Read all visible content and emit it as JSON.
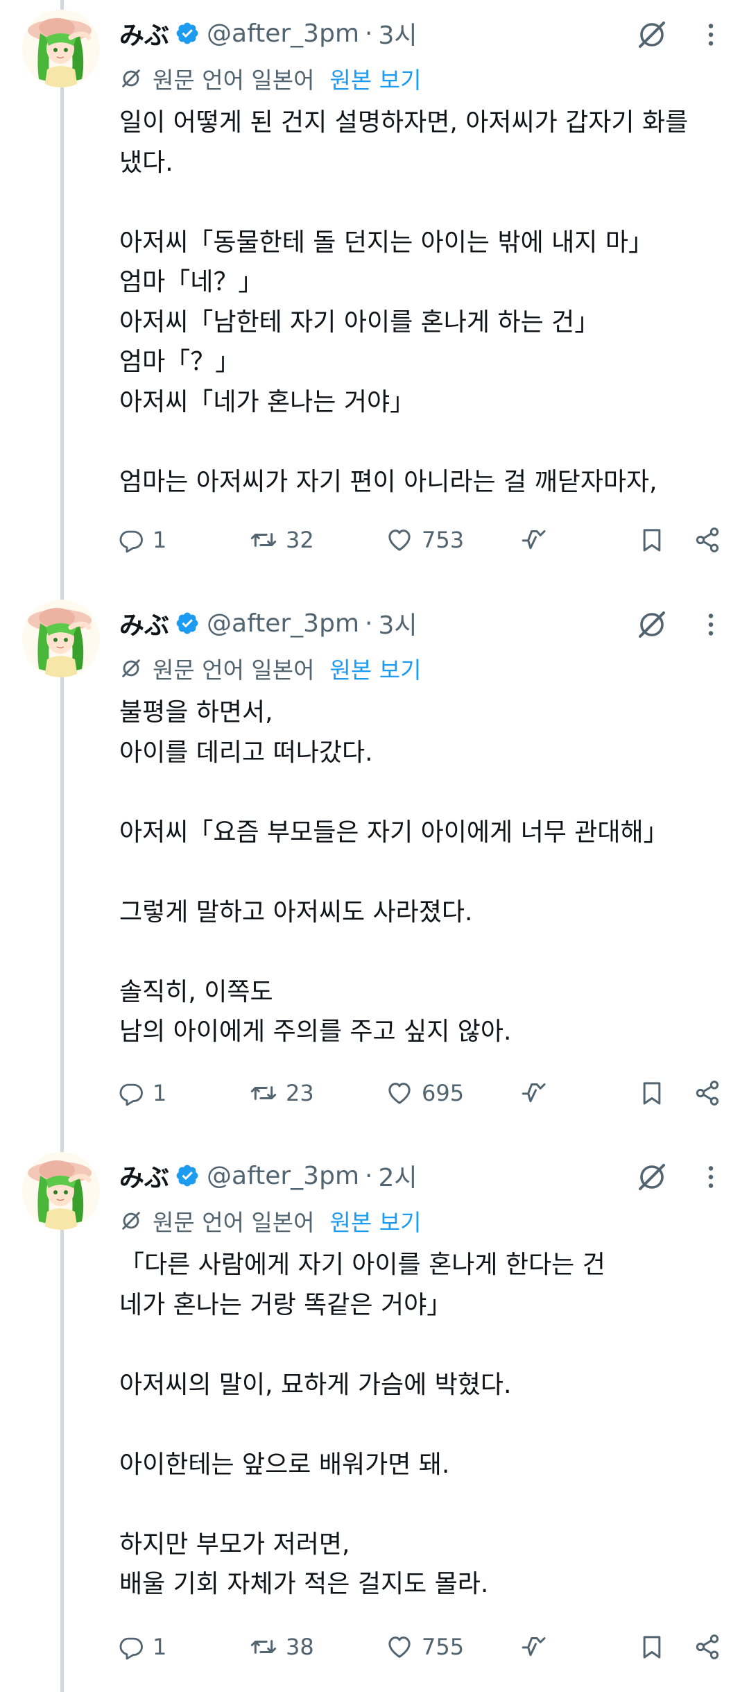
{
  "tweets": [
    {
      "author_name": "みぶ",
      "handle": "@after_3pm",
      "separator": "·",
      "time": "3시",
      "translation_note": "원문 언어 일본어",
      "show_original": "원본 보기",
      "lines": [
        "일이 어떻게 된 건지 설명하자면, 아저씨가 갑자기 화를",
        "냈다.",
        "",
        "아저씨「동물한테 돌 던지는 아이는 밖에 내지 마」",
        "엄마「네？」",
        "아저씨「남한테 자기 아이를 혼나게 하는 건」",
        "엄마「？」",
        "아저씨「네가 혼나는 거야」",
        "",
        "엄마는 아저씨가 자기 편이 아니라는 걸 깨닫자마자,"
      ],
      "replies": "1",
      "reposts": "32",
      "likes": "753"
    },
    {
      "author_name": "みぶ",
      "handle": "@after_3pm",
      "separator": "·",
      "time": "3시",
      "translation_note": "원문 언어 일본어",
      "show_original": "원본 보기",
      "lines": [
        "불평을 하면서,",
        "아이를 데리고 떠나갔다.",
        "",
        "아저씨「요즘 부모들은 자기 아이에게 너무 관대해」",
        "",
        "그렇게 말하고 아저씨도 사라졌다.",
        "",
        "솔직히, 이쪽도",
        "남의 아이에게 주의를 주고 싶지 않아."
      ],
      "replies": "1",
      "reposts": "23",
      "likes": "695"
    },
    {
      "author_name": "みぶ",
      "handle": "@after_3pm",
      "separator": "·",
      "time": "2시",
      "translation_note": "원문 언어 일본어",
      "show_original": "원본 보기",
      "lines": [
        "「다른 사람에게 자기 아이를 혼나게 한다는 건",
        "네가 혼나는 거랑 똑같은 거야」",
        "",
        "아저씨의 말이, 묘하게 가슴에 박혔다.",
        "",
        "아이한테는 앞으로 배워가면 돼.",
        "",
        "하지만 부모가 저러면,",
        "배울 기회 자체가 적은 걸지도 몰라."
      ],
      "replies": "1",
      "reposts": "38",
      "likes": "755"
    }
  ],
  "icons": {
    "verified": "verified-badge-icon",
    "grok": "grok-icon",
    "more": "more-options-icon",
    "translate": "translate-icon",
    "reply": "reply-icon",
    "repost": "repost-icon",
    "like": "like-icon",
    "stats": "stats-icon",
    "bookmark": "bookmark-icon",
    "share": "share-icon"
  },
  "colors": {
    "text": "#0f1419",
    "secondary": "#536471",
    "link": "#1d9bf0",
    "verified": "#1d9bf0",
    "thread_line": "#cfd9de"
  }
}
